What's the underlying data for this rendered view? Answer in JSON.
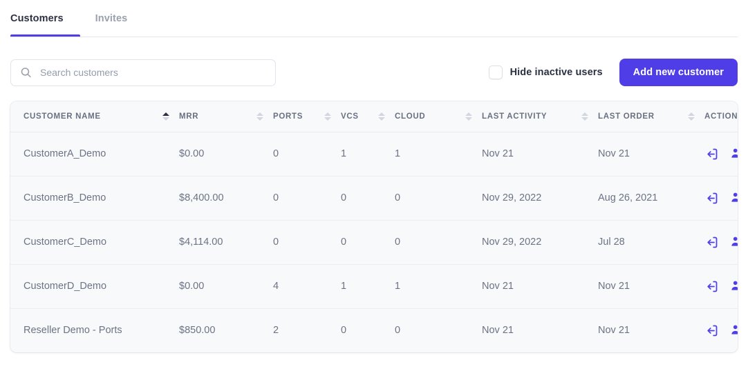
{
  "tabs": [
    {
      "label": "Customers",
      "active": true
    },
    {
      "label": "Invites",
      "active": false
    }
  ],
  "toolbar": {
    "search_placeholder": "Search customers",
    "search_value": "",
    "search_icon": "search-icon",
    "hide_inactive_label": "Hide inactive users",
    "hide_inactive_checked": false,
    "add_customer_label": "Add new customer"
  },
  "colors": {
    "accent": "#4f3ee8",
    "text_primary": "#2c3142",
    "text_secondary": "#6b7384",
    "header_text": "#697080",
    "card_bg": "#f8f9fb",
    "border": "#ebedf2"
  },
  "table": {
    "columns": [
      {
        "label": "CUSTOMER NAME",
        "sortable": true,
        "sort": "asc"
      },
      {
        "label": "MRR",
        "sortable": true,
        "sort": "none"
      },
      {
        "label": "PORTS",
        "sortable": true,
        "sort": "none"
      },
      {
        "label": "VCS",
        "sortable": true,
        "sort": "none"
      },
      {
        "label": "CLOUD",
        "sortable": true,
        "sort": "none"
      },
      {
        "label": "LAST ACTIVITY",
        "sortable": true,
        "sort": "none"
      },
      {
        "label": "LAST ORDER",
        "sortable": true,
        "sort": "none"
      },
      {
        "label": "ACTION",
        "sortable": false,
        "sort": "none"
      }
    ],
    "rows": [
      {
        "name": "CustomerA_Demo",
        "mrr": "$0.00",
        "ports": "0",
        "vcs": "1",
        "cloud": "1",
        "last_activity": "Nov 21",
        "last_order": "Nov 21",
        "actions": [
          "login-icon",
          "users-icon"
        ]
      },
      {
        "name": "CustomerB_Demo",
        "mrr": "$8,400.00",
        "ports": "0",
        "vcs": "0",
        "cloud": "0",
        "last_activity": "Nov 29, 2022",
        "last_order": "Aug 26, 2021",
        "actions": [
          "login-icon",
          "users-icon"
        ]
      },
      {
        "name": "CustomerC_Demo",
        "mrr": "$4,114.00",
        "ports": "0",
        "vcs": "0",
        "cloud": "0",
        "last_activity": "Nov 29, 2022",
        "last_order": "Jul 28",
        "actions": [
          "login-icon",
          "users-icon"
        ]
      },
      {
        "name": "CustomerD_Demo",
        "mrr": "$0.00",
        "ports": "4",
        "vcs": "1",
        "cloud": "1",
        "last_activity": "Nov 21",
        "last_order": "Nov 21",
        "actions": [
          "login-icon",
          "users-icon"
        ]
      },
      {
        "name": "Reseller Demo - Ports",
        "mrr": "$850.00",
        "ports": "2",
        "vcs": "0",
        "cloud": "0",
        "last_activity": "Nov 21",
        "last_order": "Nov 21",
        "actions": [
          "login-icon",
          "users-icon"
        ]
      }
    ]
  }
}
